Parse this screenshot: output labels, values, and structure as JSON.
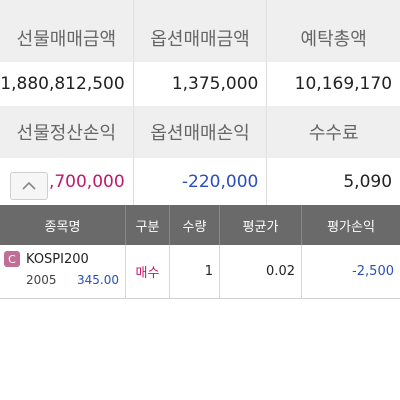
{
  "summary": {
    "row1": [
      "선물매매금액",
      "옵션매매금액",
      "예탁총액"
    ],
    "row2": [
      "1,880,812,500",
      "1,375,000",
      "10,169,170"
    ],
    "row3": [
      "선물정산손익",
      "옵션매매손익",
      "수수료"
    ],
    "row4": [
      "1,700,000",
      "-220,000",
      "5,090"
    ]
  },
  "colors": {
    "positive": "#c2186b",
    "negative": "#2a4fb8",
    "header_bg": "#6a6a6a"
  },
  "collapse_icon": "chevron-up-icon",
  "grid": {
    "headers": [
      "종목명",
      "구분",
      "수량",
      "평균가",
      "평가손익"
    ],
    "rows": [
      {
        "badge": "C",
        "name": "KOSPI200",
        "code": "2005",
        "price": "345.00",
        "type": "매수",
        "qty": "1",
        "avg": "0.02",
        "pnl": "-2,500"
      }
    ]
  }
}
